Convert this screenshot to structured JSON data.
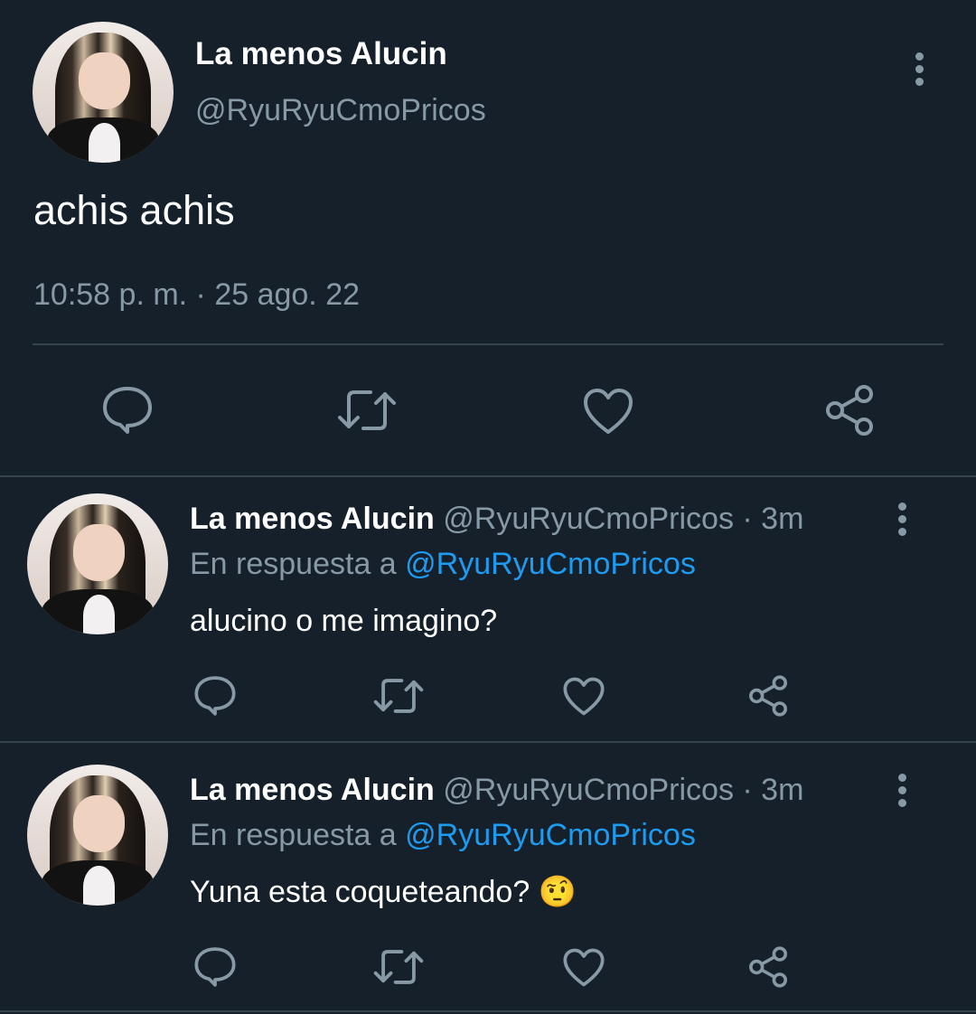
{
  "main_tweet": {
    "display_name": "La menos Alucin",
    "handle": "@RyuRyuCmoPricos",
    "text": "achis achis",
    "timestamp": "10:58 p. m. · 25 ago. 22",
    "actions": [
      "reply-icon",
      "retweet-icon",
      "like-icon",
      "share-icon"
    ]
  },
  "replies": [
    {
      "display_name": "La menos Alucin",
      "handle": "@RyuRyuCmoPricos",
      "age": "· 3m",
      "reply_prefix": "En respuesta a",
      "reply_to": "@RyuRyuCmoPricos",
      "text": "alucino o me imagino?"
    },
    {
      "display_name": "La menos Alucin",
      "handle": "@RyuRyuCmoPricos",
      "age": "· 3m",
      "reply_prefix": "En respuesta a",
      "reply_to": "@RyuRyuCmoPricos",
      "text": "Yuna esta coqueteando? ",
      "emoji": "🤨"
    }
  ],
  "colors": {
    "background": "#15202b",
    "text": "#ffffff",
    "muted": "#8899a6",
    "link": "#1d9bf0",
    "divider": "#38444d"
  }
}
